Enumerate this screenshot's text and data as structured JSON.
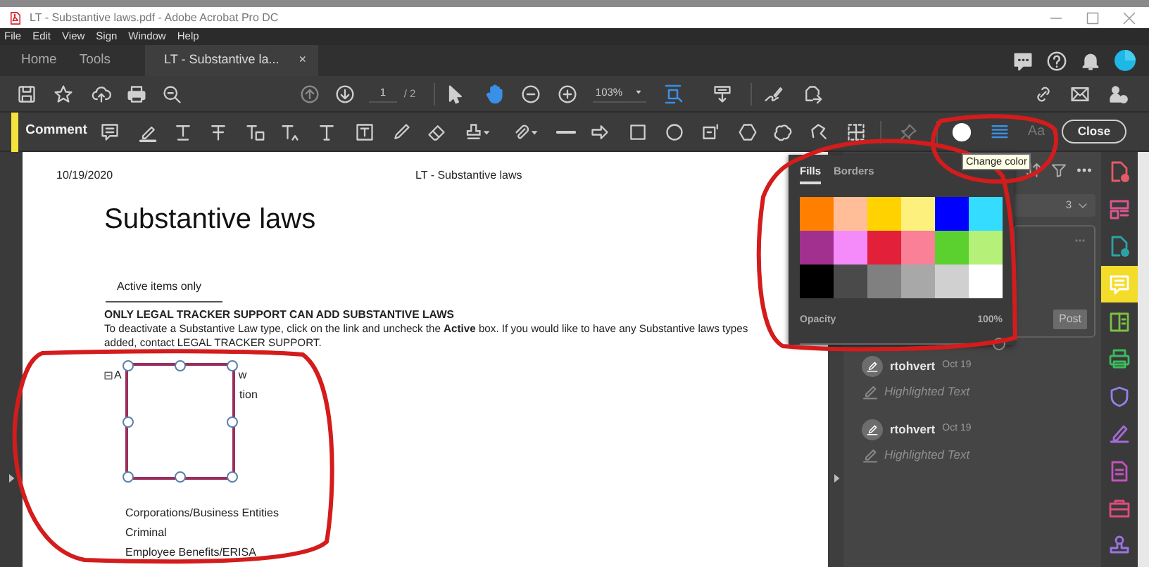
{
  "window": {
    "title": "LT - Substantive laws.pdf - Adobe Acrobat Pro DC"
  },
  "menu": [
    "File",
    "Edit",
    "View",
    "Sign",
    "Window",
    "Help"
  ],
  "tabs": [
    {
      "label": "Home",
      "selected": false
    },
    {
      "label": "Tools",
      "selected": false
    },
    {
      "label": "LT - Substantive la...",
      "selected": true,
      "close": "×"
    }
  ],
  "toolbar": {
    "page": "1",
    "page_total": "/ 2",
    "zoom": "103%"
  },
  "comment_toolbar": {
    "title": "Comment",
    "color": "#ffffff",
    "font_label": "Aa",
    "close": "Close"
  },
  "document": {
    "date": "10/19/2020",
    "header": "LT - Substantive laws",
    "title": "Substantive laws",
    "filter": "Active items only",
    "notice": "ONLY LEGAL TRACKER SUPPORT CAN ADD SUBSTANTIVE LAWS",
    "instructions": "To deactivate a Substantive Law type, click on the link and uncheck the **Active** box. If you would like to have any Substantive laws types added, contact LEGAL TRACKER SUPPORT.",
    "tree": {
      "expanded": true,
      "fragments": [
        "A",
        "w"
      ],
      "partial_row": "tion",
      "children": [
        "Corporations/Business Entities",
        "Criminal",
        "Employee Benefits/ERISA"
      ]
    }
  },
  "tooltip": "Change color",
  "color_popup": {
    "tabs": [
      {
        "label": "Fills",
        "selected": true
      },
      {
        "label": "Borders",
        "selected": false
      }
    ],
    "swatches": [
      {
        "color": "#ff7f00"
      },
      {
        "color": "#ffbe98"
      },
      {
        "color": "#ffd200"
      },
      {
        "color": "#fdf07c"
      },
      {
        "color": "#0000ff"
      },
      {
        "color": "#34dcff"
      },
      {
        "color": "#a2308e"
      },
      {
        "color": "#f58bfb"
      },
      {
        "color": "#e2203a"
      },
      {
        "color": "#f98097"
      },
      {
        "color": "#5ad12e"
      },
      {
        "color": "#b5f078"
      },
      {
        "color": "#000000"
      },
      {
        "color": "#4a4a4a"
      },
      {
        "color": "#808080"
      },
      {
        "color": "#a8a8a8"
      },
      {
        "color": "#d0d0d0"
      },
      {
        "color": "#ffffff"
      }
    ],
    "opacity_label": "Opacity",
    "opacity_value": "100%",
    "opacity": {
      "level": 1
    }
  },
  "comments_pane": {
    "page_filter": "3",
    "post": "Post",
    "comments": [
      {
        "author": "rtohvert",
        "date": "Oct 19",
        "text": "Highlighted Text"
      },
      {
        "author": "rtohvert",
        "date": "Oct 19",
        "text": "Highlighted Text"
      }
    ]
  }
}
